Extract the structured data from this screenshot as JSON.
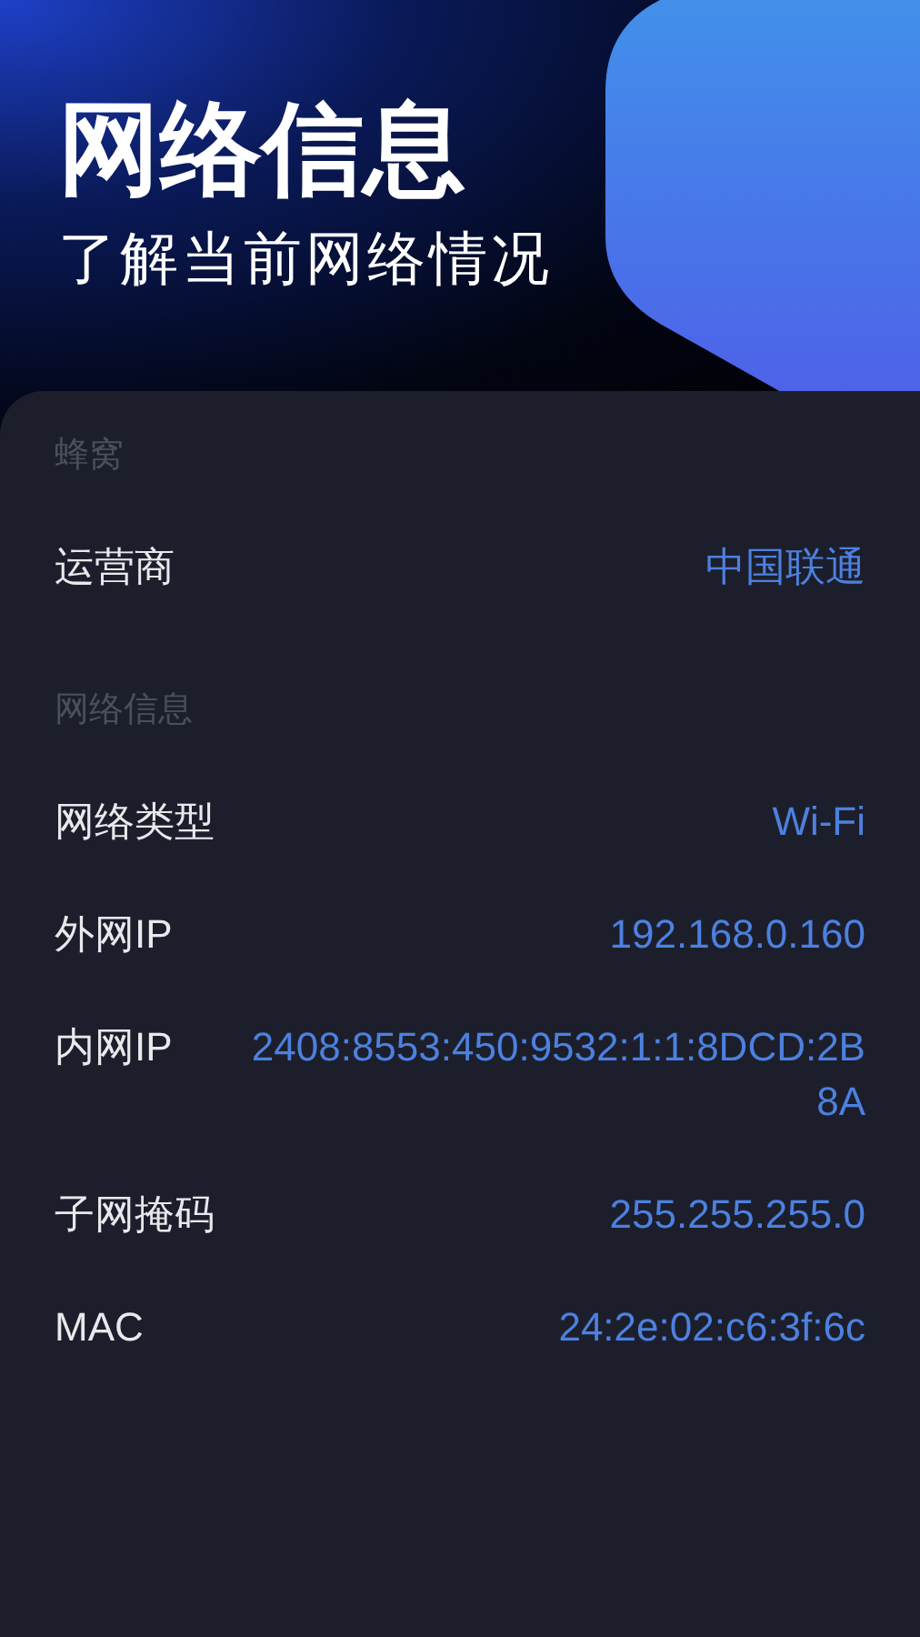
{
  "header": {
    "title": "网络信息",
    "subtitle": "了解当前网络情况"
  },
  "sections": [
    {
      "title": "蜂窝",
      "rows": [
        {
          "label": "运营商",
          "value": "中国联通"
        }
      ]
    },
    {
      "title": "网络信息",
      "rows": [
        {
          "label": "网络类型",
          "value": "Wi-Fi"
        },
        {
          "label": "外网IP",
          "value": "192.168.0.160"
        },
        {
          "label": "内网IP",
          "value": "2408:8553:450:9532:1:1:8DCD:2B8A"
        },
        {
          "label": "子网掩码",
          "value": "255.255.255.0"
        },
        {
          "label": "MAC",
          "value": "24:2e:02:c6:3f:6c"
        }
      ]
    }
  ]
}
